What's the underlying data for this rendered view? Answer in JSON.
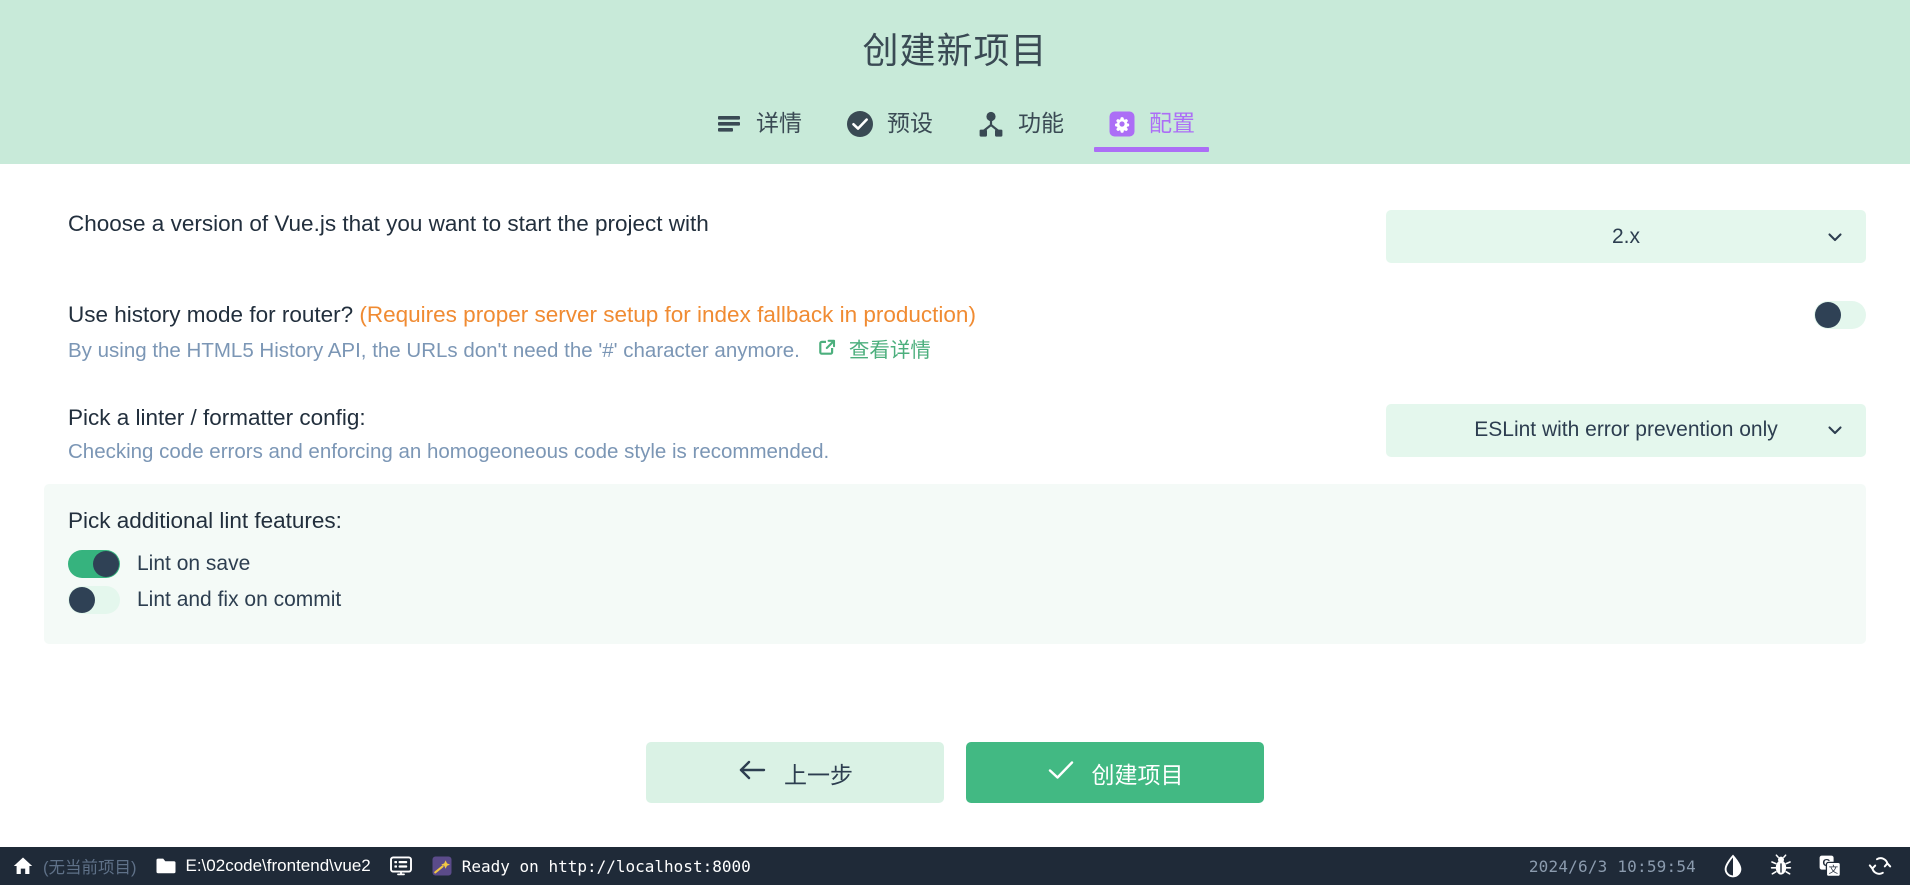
{
  "header": {
    "title": "创建新项目",
    "tabs": [
      {
        "label": "详情",
        "icon": "list-lines-icon",
        "active": false
      },
      {
        "label": "预设",
        "icon": "check-circle-icon",
        "active": false
      },
      {
        "label": "功能",
        "icon": "node-hierarchy-icon",
        "active": false
      },
      {
        "label": "配置",
        "icon": "gear-square-icon",
        "active": true
      }
    ],
    "active_accent": "#ac6ef6",
    "background": "#c8ead9"
  },
  "main": {
    "version_prompt": {
      "question": "Choose a version of Vue.js that you want to start the project with",
      "selected": "2.x",
      "chevron": "chevron-down-icon"
    },
    "history_prompt": {
      "question": "Use history mode for router?",
      "warning": "(Requires proper server setup for index fallback in production)",
      "description": "By using the HTML5 History API, the URLs don't need the '#' character anymore.",
      "link_label": "查看详情",
      "link_icon": "external-link-icon",
      "toggle_on": false
    },
    "linter_prompt": {
      "question": "Pick a linter / formatter config:",
      "description": "Checking code errors and enforcing an homogeoneous code style is recommended.",
      "selected": "ESLint with error prevention only",
      "chevron": "chevron-down-icon"
    },
    "lint_features": {
      "title": "Pick additional lint features:",
      "items": [
        {
          "label": "Lint on save",
          "on": true
        },
        {
          "label": "Lint and fix on commit",
          "on": false
        }
      ]
    },
    "buttons": {
      "back": {
        "label": "上一步",
        "icon": "arrow-left-icon"
      },
      "create": {
        "label": "创建项目",
        "icon": "check-icon"
      }
    }
  },
  "statusbar": {
    "home_icon": "home-icon",
    "project_name": "(无当前项目)",
    "folder_icon": "folder-icon",
    "project_path": "E:\\02code\\frontend\\vue2",
    "terminal_icon": "terminal-icon",
    "task_icon": "comet-icon",
    "task_status": "Ready on http://localhost:8000",
    "datetime": "2024/6/3 10:59:54",
    "right_icons": [
      "theme-droplet-icon",
      "bug-icon",
      "translate-icon",
      "refresh-icon"
    ]
  },
  "colors": {
    "header_bg": "#c8ead9",
    "accent_purple": "#ac6ef6",
    "accent_green": "#42b983",
    "toggle_on": "#36b37e",
    "toggle_knob": "#2f4155",
    "warn_orange": "#f08b32",
    "muted_blue": "#7b96b5",
    "statusbar_bg": "#1f2a38"
  }
}
